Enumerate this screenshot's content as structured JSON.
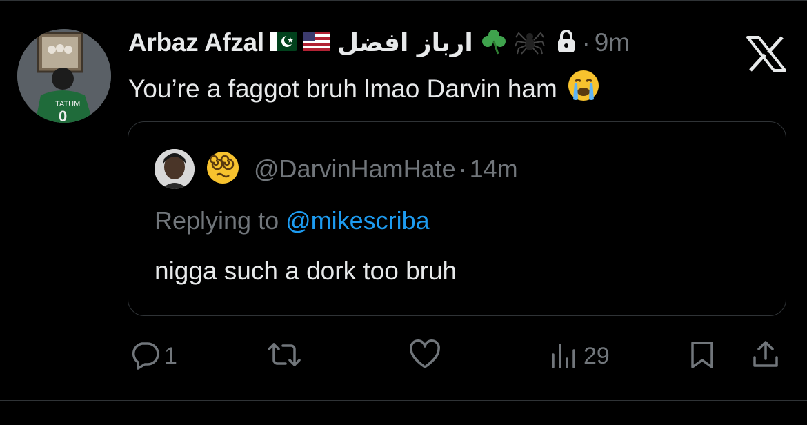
{
  "tweet": {
    "author_name": "Arbaz Afzal",
    "author_urdu": "ارباز افضل",
    "time": "9m",
    "separator": "·",
    "text": "You’re a faggot bruh lmao Darvin ham",
    "icons": [
      "pakistan-flag-icon",
      "us-flag-icon",
      "shamrock-icon",
      "spider-icon",
      "lock-icon",
      "crying-face-emoji"
    ]
  },
  "quote": {
    "handle": "@DarvinHamHate",
    "separator": "·",
    "time": "14m",
    "replying_prefix": "Replying to ",
    "replying_mention": "@mikescriba",
    "text": "nigga such a dork too bruh"
  },
  "actions": {
    "reply_count": "1",
    "views_count": "29"
  },
  "colors": {
    "background": "#000000",
    "text": "#e7e9ea",
    "secondary": "#71767b",
    "link": "#1d9bf0",
    "border": "#2f3336"
  }
}
